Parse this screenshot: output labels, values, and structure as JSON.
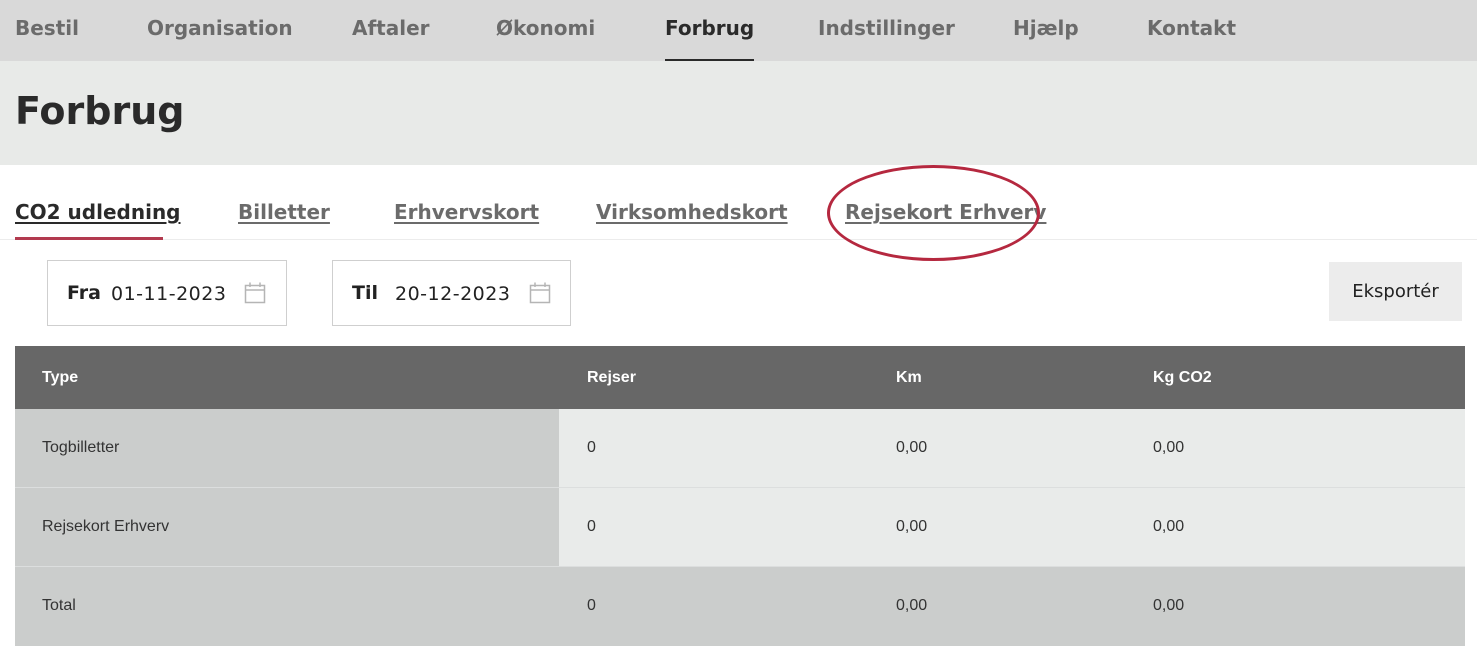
{
  "nav": {
    "items": [
      {
        "label": "Bestil"
      },
      {
        "label": "Organisation"
      },
      {
        "label": "Aftaler"
      },
      {
        "label": "Økonomi"
      },
      {
        "label": "Forbrug",
        "active": true
      },
      {
        "label": "Indstillinger"
      },
      {
        "label": "Hjælp"
      },
      {
        "label": "Kontakt"
      }
    ]
  },
  "page": {
    "title": "Forbrug"
  },
  "subtabs": {
    "items": [
      {
        "label": "CO2 udledning",
        "active": true
      },
      {
        "label": "Billetter"
      },
      {
        "label": "Erhvervskort"
      },
      {
        "label": "Virksomhedskort"
      },
      {
        "label": "Rejsekort Erhverv"
      }
    ]
  },
  "filters": {
    "from": {
      "label": "Fra",
      "value": "01-11-2023",
      "icon": "calendar-icon"
    },
    "to": {
      "label": "Til",
      "value": "20-12-2023",
      "icon": "calendar-icon"
    },
    "export_label": "Eksportér"
  },
  "table": {
    "headers": [
      "Type",
      "Rejser",
      "Km",
      "Kg CO2"
    ],
    "rows": [
      [
        "Togbilletter",
        "0",
        "0,00",
        "0,00"
      ],
      [
        "Rejsekort Erhverv",
        "0",
        "0,00",
        "0,00"
      ]
    ],
    "total": [
      "Total",
      "0",
      "0,00",
      "0,00"
    ]
  },
  "colors": {
    "accent": "#b23a4f",
    "annotation": "#b5283f",
    "table_header": "#676767",
    "nav_bg": "#d9d9d9"
  }
}
